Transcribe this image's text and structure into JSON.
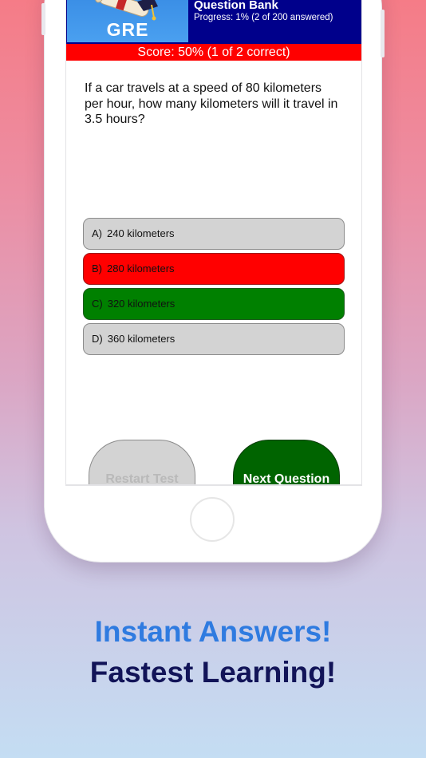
{
  "app": {
    "logo_text": "GRE",
    "title": "Question Bank",
    "progress": "Progress: 1% (2 of 200 answered)"
  },
  "score": {
    "text": "Score: 50% (1 of 2 correct)"
  },
  "question": {
    "text": "If a car travels at a speed of 80 kilometers per hour, how many kilometers will it travel in 3.5 hours?"
  },
  "answers": [
    {
      "letter": "A)",
      "text": "240 kilometers",
      "state": "neutral"
    },
    {
      "letter": "B)",
      "text": "280 kilometers",
      "state": "wrong"
    },
    {
      "letter": "C)",
      "text": "320 kilometers",
      "state": "correct"
    },
    {
      "letter": "D)",
      "text": "360 kilometers",
      "state": "neutral"
    }
  ],
  "buttons": {
    "restart_label": "Restart Test",
    "next_label": "Next Question"
  },
  "promo": {
    "line1": "Instant Answers!",
    "line2": "Fastest Learning!"
  },
  "colors": {
    "header": "#00008b",
    "score_bar": "#ff0000",
    "wrong": "#ff0000",
    "correct": "#008000",
    "next_button": "#006400",
    "promo_line1": "#2f7be0",
    "promo_line2": "#121458"
  },
  "icons": {
    "logo": "diploma-graduation-cap-icon",
    "home": "home-button-icon"
  }
}
